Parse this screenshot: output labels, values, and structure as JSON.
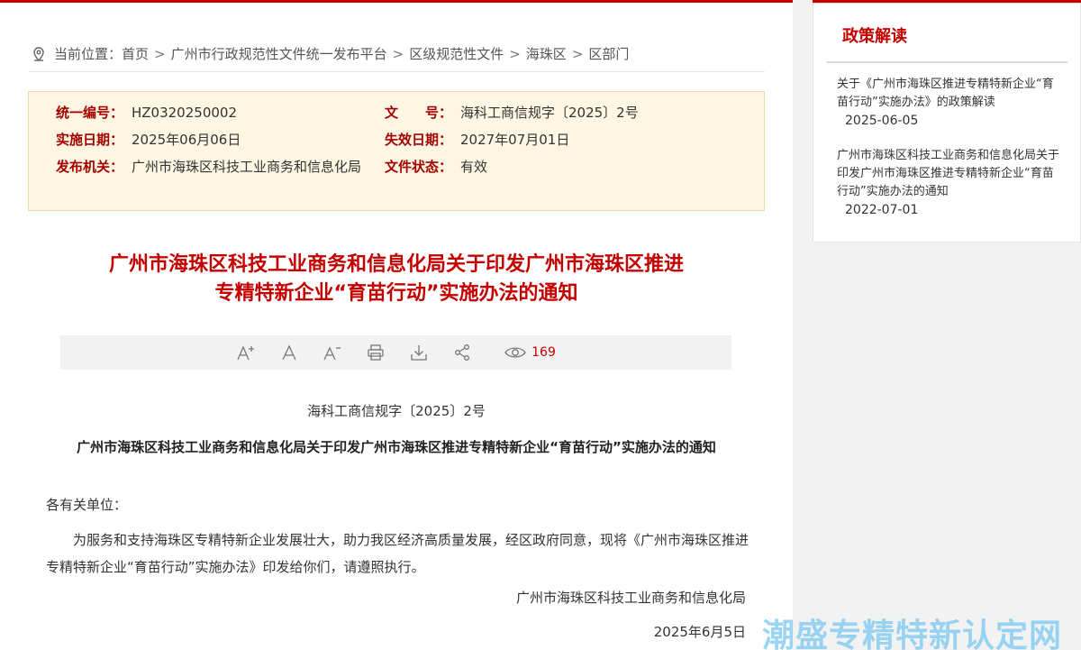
{
  "breadcrumb": {
    "prefix": "当前位置：",
    "items": [
      "首页",
      "广州市行政规范性文件统一发布平台",
      "区级规范性文件",
      "海珠区",
      "区部门"
    ],
    "separator": ">"
  },
  "meta": {
    "unified_number_label": "统一编号：",
    "unified_number": "HZ0320250002",
    "doc_number_label": "文　　号：",
    "doc_number": "海科工商信规字〔2025〕2号",
    "effective_date_label": "实施日期：",
    "effective_date": "2025年06月06日",
    "expiry_date_label": "失效日期：",
    "expiry_date": "2027年07月01日",
    "issuer_label": "发布机关：",
    "issuer": "广州市海珠区科技工业商务和信息化局",
    "status_label": "文件状态：",
    "status": "有效"
  },
  "document": {
    "title_line1": "广州市海珠区科技工业商务和信息化局关于印发广州市海珠区推进",
    "title_line2": "专精特新企业“育苗行动”实施办法的通知",
    "doc_number": "海科工商信规字〔2025〕2号",
    "subtitle": "广州市海珠区科技工业商务和信息化局关于印发广州市海珠区推进专精特新企业“育苗行动”实施办法的通知",
    "salutation": "各有关单位：",
    "body": "为服务和支持海珠区专精特新企业发展壮大，助力我区经济高质量发展，经区政府同意，现将《广州市海珠区推进专精特新企业“育苗行动”实施办法》印发给你们，请遵照执行。",
    "sign_org": "广州市海珠区科技工业商务和信息化局",
    "sign_date": "2025年6月5日"
  },
  "toolbar": {
    "icons": [
      "font-increase-icon",
      "font-normal-icon",
      "font-decrease-icon",
      "print-icon",
      "download-icon",
      "share-icon",
      "eye-icon"
    ],
    "views": "169"
  },
  "side": {
    "title": "政策解读",
    "items": [
      {
        "text": "关于《广州市海珠区推进专精特新企业“育苗行动”实施办法》的政策解读",
        "date": "2025-06-05"
      },
      {
        "text": "广州市海珠区科技工业商务和信息化局关于印发广州市海珠区推进专精特新企业“育苗行动”实施办法的通知",
        "date": "2022-07-01"
      }
    ]
  },
  "watermark": "潮盛专精特新认定网",
  "colors": {
    "accent": "#c40000",
    "meta_bg": "#fdf6e3",
    "watermark": "#78c8f0"
  }
}
